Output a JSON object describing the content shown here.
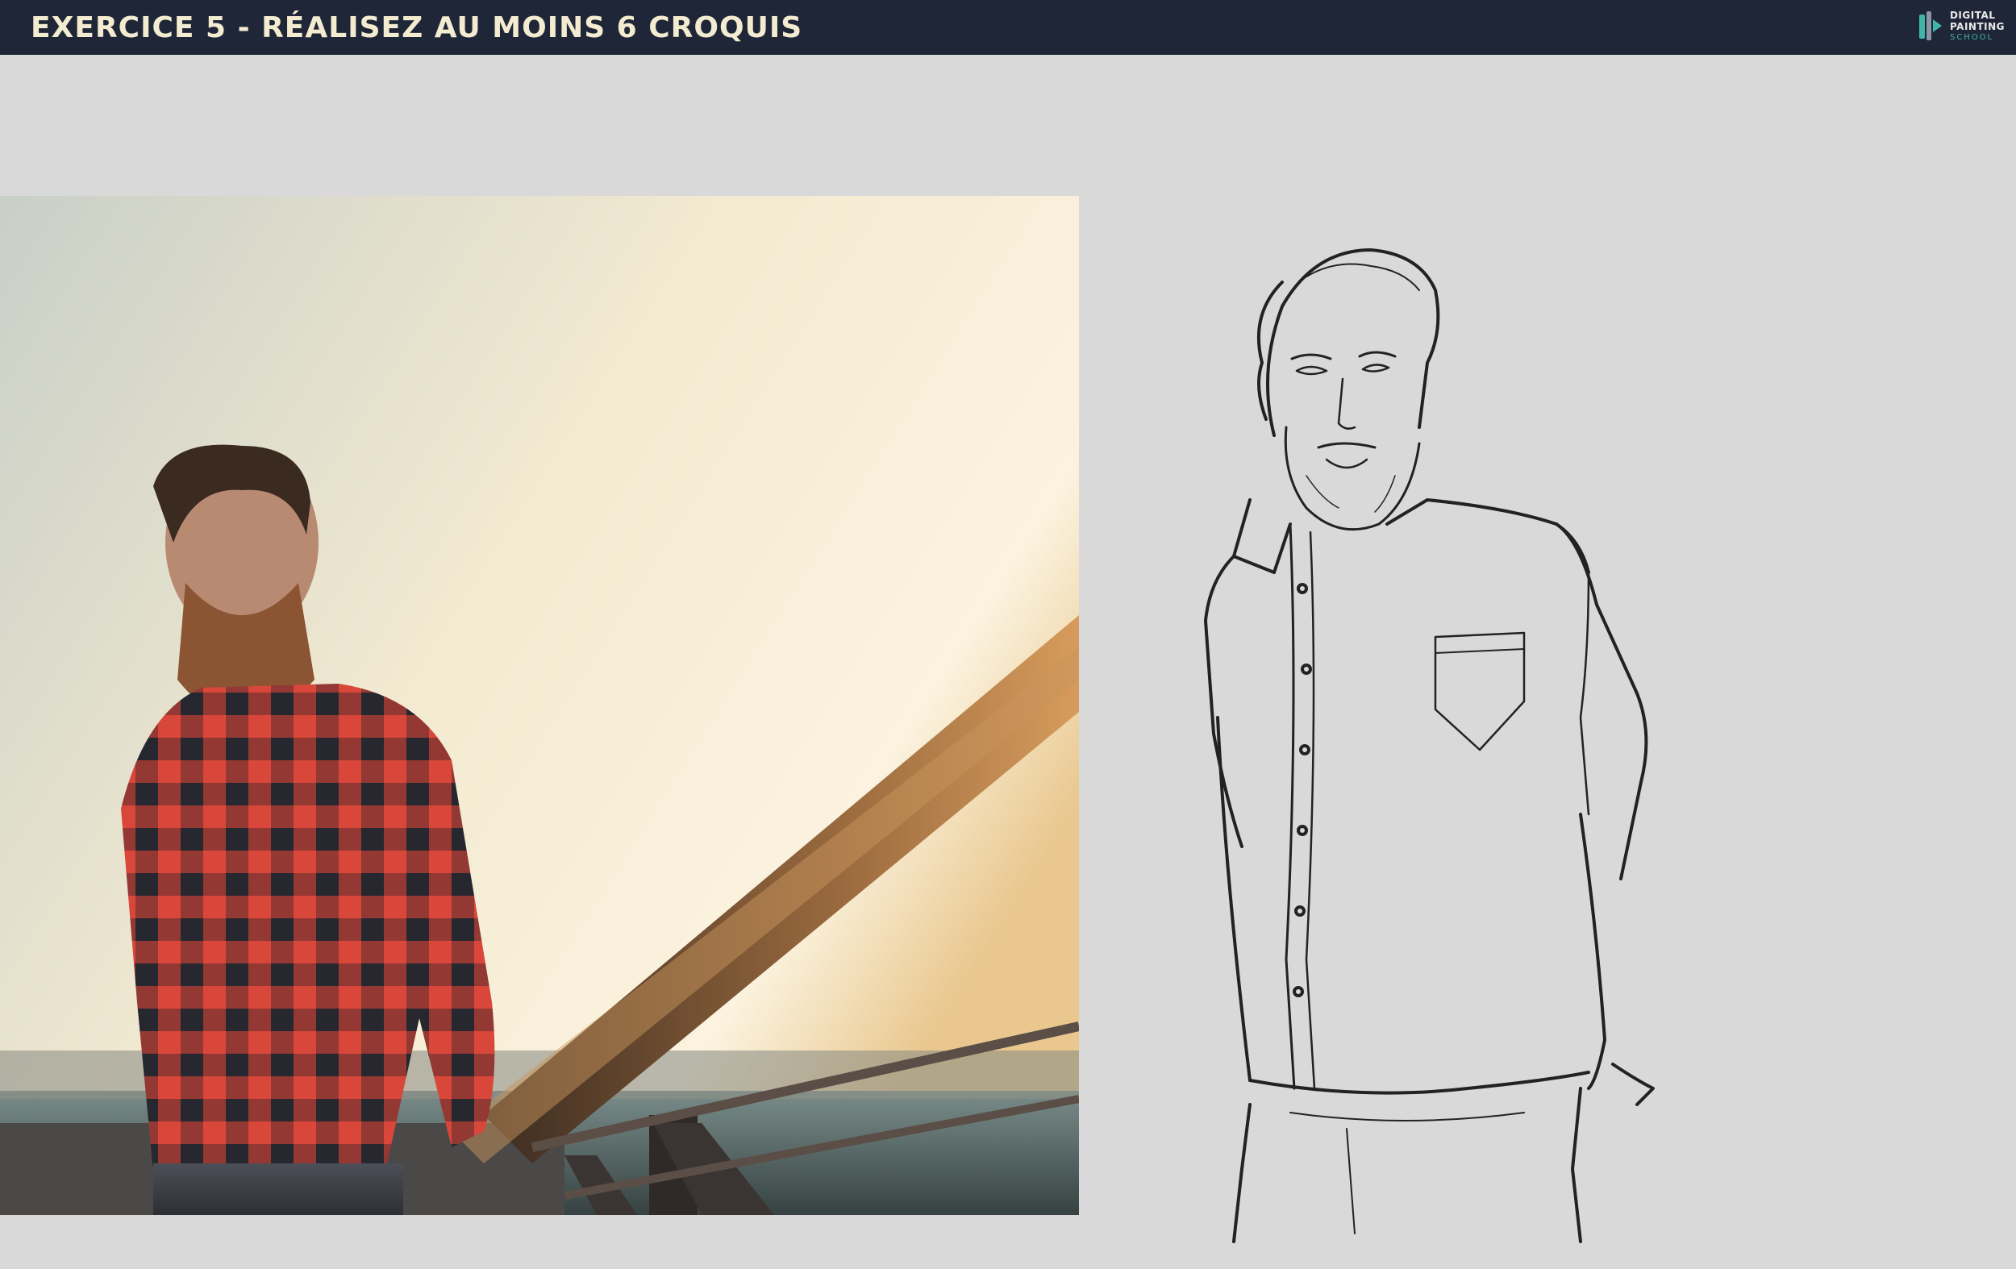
{
  "header": {
    "title": "EXERCICE 5 - RÉALISEZ AU MOINS 6 CROQUIS",
    "logo": {
      "line1": "DIGITAL",
      "line2": "PAINTING",
      "line3": "SCHOOL"
    }
  },
  "colors": {
    "topbar": "#1f2637",
    "title": "#f3ecd0",
    "background": "#d9d9d9",
    "logo_accent": "#3fb6a8"
  },
  "content": {
    "photo_icon": "reference-photo-man-plaid-shirt",
    "sketch_icon": "line-sketch-man-shirt"
  }
}
